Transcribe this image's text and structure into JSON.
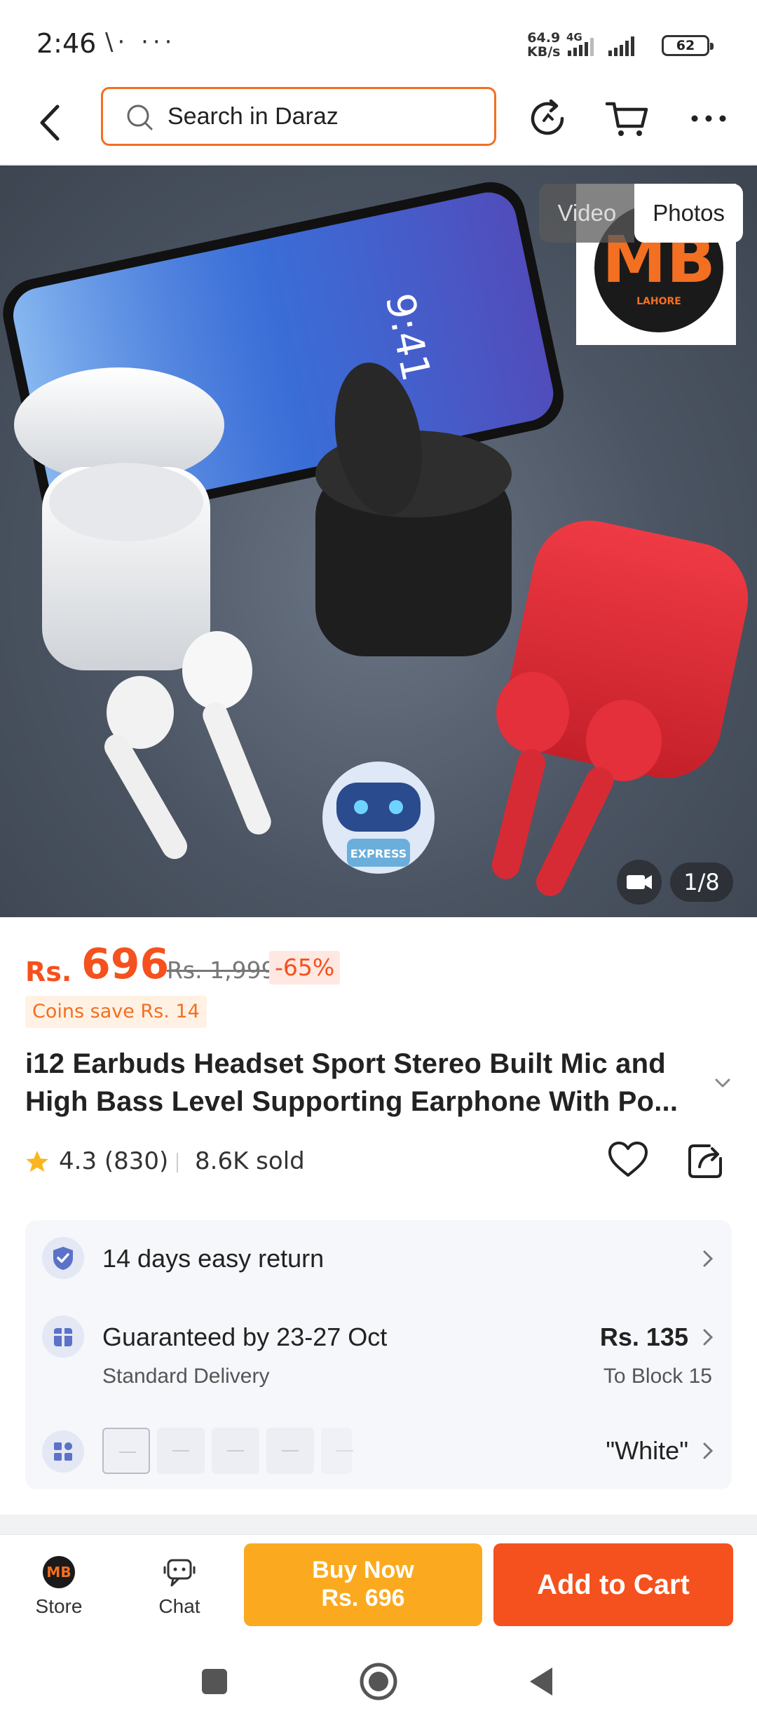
{
  "status_bar": {
    "time": "2:46",
    "left_icons": "\\· ···",
    "net_speed_value": "64.9",
    "net_speed_unit": "KB/s",
    "network_type": "4G",
    "battery": "62"
  },
  "nav": {
    "search_placeholder": "Search in Daraz",
    "icons": [
      "back-arrow-icon",
      "search-icon",
      "refresh-icon",
      "cart-icon",
      "more-icon"
    ]
  },
  "gallery": {
    "video_tab": "Video",
    "photos_tab": "Photos",
    "store_logo_text": "MB",
    "store_logo_sub": "LAHORE",
    "mascot_text": "EXPRESS",
    "phone_time": "9:41",
    "counter": "1/8"
  },
  "product": {
    "currency": "Rs.",
    "price": "696",
    "original_price": "Rs. 1,999",
    "discount": "-65%",
    "coins_save": "Coins save Rs. 14",
    "title": "i12 Earbuds Headset Sport Stereo Built Mic and High Bass Level Supporting Earphone With Po...",
    "rating": "4.3 (830)",
    "sold": "8.6K sold"
  },
  "info": {
    "return_text": "14 days easy return",
    "delivery_main": "Guaranteed by 23-27 Oct",
    "delivery_sub": "Standard Delivery",
    "delivery_fee": "Rs. 135",
    "delivery_location": "To Block 15",
    "variant_selected": "\"White\""
  },
  "bottom_bar": {
    "store_label": "Store",
    "store_logo": "MB",
    "chat_label": "Chat",
    "buy_now_line1": "Buy Now",
    "buy_now_line2": "Rs. 696",
    "add_to_cart": "Add to Cart"
  },
  "colors": {
    "accent_orange": "#f4511e",
    "buy_now_yellow": "#fbaa1f",
    "search_border": "#f36f21"
  }
}
